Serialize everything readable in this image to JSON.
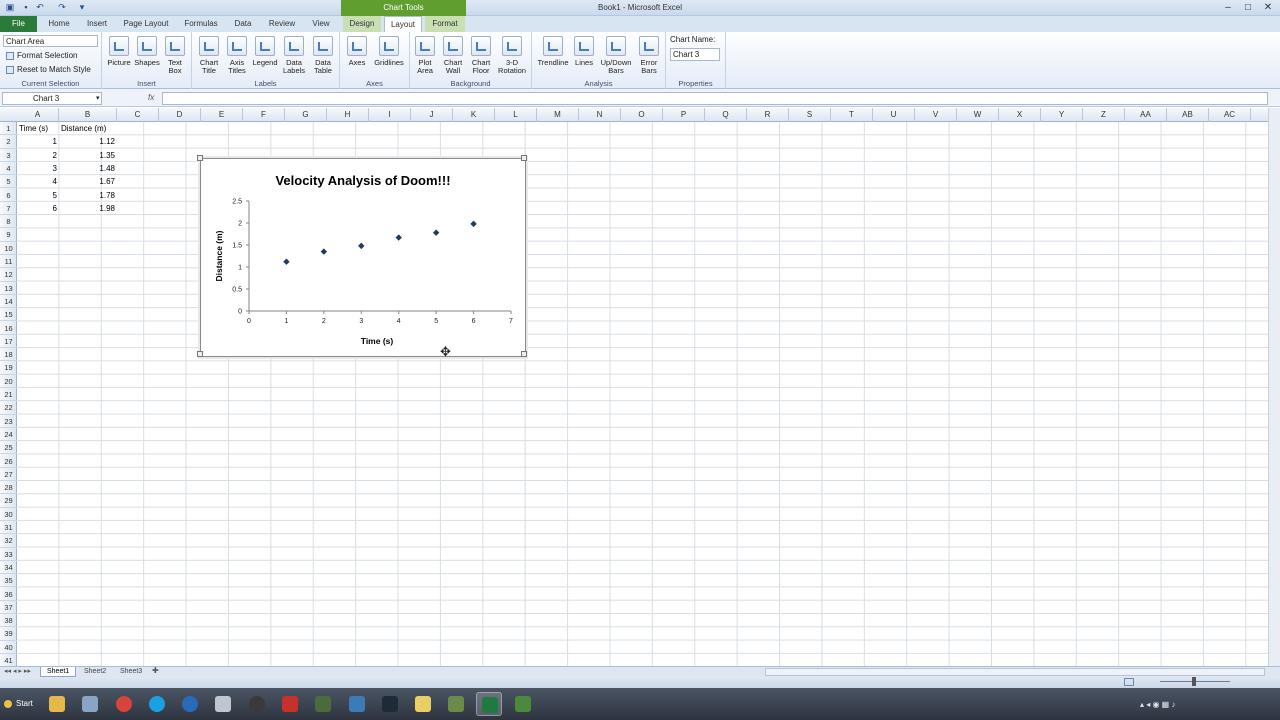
{
  "window": {
    "title": "Book1 - Microsoft Excel",
    "chart_tools": "Chart Tools"
  },
  "tabs": {
    "file": "File",
    "home": "Home",
    "insert": "Insert",
    "page_layout": "Page Layout",
    "formulas": "Formulas",
    "data": "Data",
    "review": "Review",
    "view": "View",
    "design": "Design",
    "layout": "Layout",
    "format": "Format"
  },
  "ribbon": {
    "current_selection": {
      "dropdown": "Chart Area",
      "format_selection": "Format Selection",
      "reset": "Reset to Match Style",
      "label": "Current Selection"
    },
    "insert": {
      "picture": "Picture",
      "shapes": "Shapes",
      "text_box": "Text Box",
      "label": "Insert"
    },
    "labels": {
      "chart_title": "Chart Title",
      "axis_titles": "Axis Titles",
      "legend": "Legend",
      "data_labels": "Data Labels",
      "data_table": "Data Table",
      "label": "Labels"
    },
    "axes": {
      "axes": "Axes",
      "gridlines": "Gridlines",
      "label": "Axes"
    },
    "background": {
      "plot_area": "Plot Area",
      "chart_wall": "Chart Wall",
      "chart_floor": "Chart Floor",
      "rotation": "3-D Rotation",
      "label": "Background"
    },
    "analysis": {
      "trendline": "Trendline",
      "lines": "Lines",
      "updown": "Up/Down Bars",
      "error_bars": "Error Bars",
      "label": "Analysis"
    },
    "properties": {
      "chart_name_label": "Chart Name:",
      "chart_name": "Chart 3",
      "label": "Properties"
    }
  },
  "formula": {
    "name_box": "Chart 3",
    "fx": "fx"
  },
  "columns": [
    "A",
    "B",
    "C",
    "D",
    "E",
    "F",
    "G",
    "H",
    "I",
    "J",
    "K",
    "L",
    "M",
    "N",
    "O",
    "P",
    "Q",
    "R",
    "S",
    "T",
    "U",
    "V",
    "W",
    "X",
    "Y",
    "Z",
    "AA",
    "AB",
    "AC"
  ],
  "rows": [
    "1",
    "2",
    "3",
    "4",
    "5",
    "6",
    "7",
    "8",
    "9",
    "10",
    "11",
    "12",
    "13",
    "14",
    "15",
    "16",
    "17",
    "18",
    "19",
    "20",
    "21",
    "22",
    "23",
    "24",
    "25",
    "26",
    "27",
    "28",
    "29",
    "30",
    "31",
    "32",
    "33",
    "34",
    "35",
    "36",
    "37",
    "38",
    "39",
    "40",
    "41"
  ],
  "table": {
    "headers": [
      "Time (s)",
      "Distance (m)"
    ],
    "time": [
      "1",
      "2",
      "3",
      "4",
      "5",
      "6"
    ],
    "distance": [
      "1.12",
      "1.35",
      "1.48",
      "1.67",
      "1.78",
      "1.98"
    ]
  },
  "chart_data": {
    "type": "scatter",
    "title": "Velocity Analysis of Doom!!!",
    "xlabel": "Time (s)",
    "ylabel": "Distance (m)",
    "x": [
      1,
      2,
      3,
      4,
      5,
      6
    ],
    "y": [
      1.12,
      1.35,
      1.48,
      1.67,
      1.78,
      1.98
    ],
    "xlim": [
      0,
      7
    ],
    "ylim": [
      0,
      2.5
    ],
    "xticks": [
      "0",
      "1",
      "2",
      "3",
      "4",
      "5",
      "6",
      "7"
    ],
    "yticks": [
      "0",
      "0.5",
      "1",
      "1.5",
      "2",
      "2.5"
    ],
    "grid": false,
    "legend": "none",
    "marker_color": "#1f3b63"
  },
  "sheets": [
    "Sheet1",
    "Sheet2",
    "Sheet3"
  ],
  "taskbar": {
    "start": "Start"
  }
}
